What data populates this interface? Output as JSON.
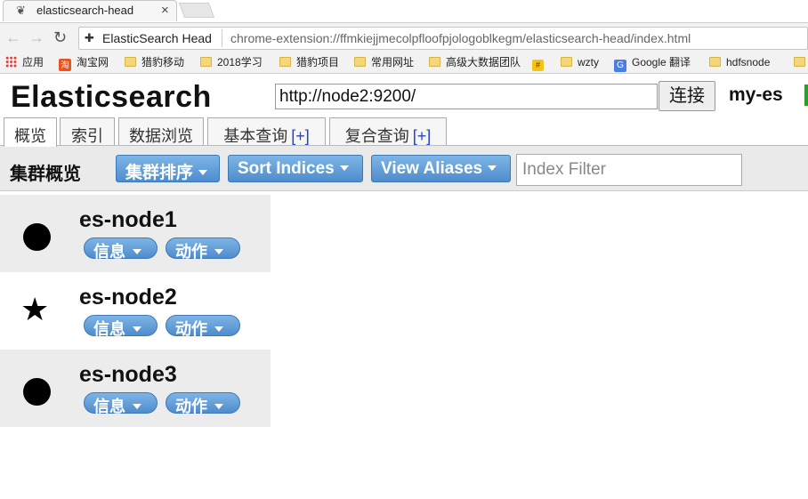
{
  "browser": {
    "tab_title": "elasticsearch-head",
    "tab_icon": "page-icon",
    "close_icon": "×",
    "extension_name": "ElasticSearch Head",
    "url": "chrome-extension://ffmkiejjmecolpfloofpjologoblkegm/elasticsearch-head/index.html"
  },
  "bookmarks": [
    {
      "label": "应用",
      "icon": "apps-icon"
    },
    {
      "label": "淘宝网",
      "icon": "taobao-icon"
    },
    {
      "label": "猎豹移动",
      "icon": "folder-icon"
    },
    {
      "label": "2018学习",
      "icon": "folder-icon"
    },
    {
      "label": "猎豹项目",
      "icon": "folder-icon"
    },
    {
      "label": "常用网址",
      "icon": "folder-icon"
    },
    {
      "label": "高级大数据团队",
      "icon": "folder-icon"
    },
    {
      "label": "",
      "icon": "hash-icon"
    },
    {
      "label": "wzty",
      "icon": "folder-icon"
    },
    {
      "label": "Google 翻译",
      "icon": "google-translate-icon"
    },
    {
      "label": "hdfsnode",
      "icon": "folder-icon"
    }
  ],
  "app": {
    "brand": "Elasticsearch",
    "connection_url": "http://node2:9200/",
    "connect_label": "连接",
    "cluster_name": "my-es",
    "health_color": "#2e9b2e"
  },
  "tabs": [
    {
      "label": "概览",
      "plus": ""
    },
    {
      "label": "索引",
      "plus": ""
    },
    {
      "label": "数据浏览",
      "plus": ""
    },
    {
      "label": "基本查询",
      "plus": "[+]"
    },
    {
      "label": "复合查询",
      "plus": "[+]"
    }
  ],
  "overview": {
    "title": "集群概览",
    "sort_cluster_label": "集群排序",
    "sort_indices_label": "Sort Indices",
    "view_aliases_label": "View Aliases",
    "index_filter_placeholder": "Index Filter"
  },
  "nodes": [
    {
      "name": "es-node1",
      "icon": "circle-icon",
      "info_label": "信息",
      "action_label": "动作"
    },
    {
      "name": "es-node2",
      "icon": "star-icon",
      "info_label": "信息",
      "action_label": "动作"
    },
    {
      "name": "es-node3",
      "icon": "circle-icon",
      "info_label": "信息",
      "action_label": "动作"
    }
  ],
  "colors": {
    "button_blue": "#5b96d2",
    "row_shade": "#ececec"
  }
}
